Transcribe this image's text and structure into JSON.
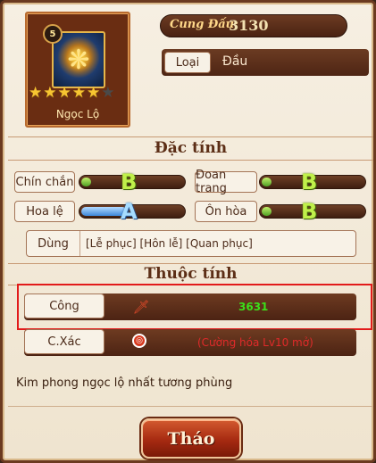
{
  "item": {
    "level": "5",
    "name": "Ngọc Lộ",
    "stars_total": 6,
    "stars_filled": 5
  },
  "power": {
    "label": "Cung Đấu:",
    "value": "3130"
  },
  "type": {
    "label": "Loại",
    "value": "Đầu"
  },
  "traits_section": {
    "title": "Đặc tính",
    "items": [
      {
        "name": "Chín chắn",
        "grade": "B",
        "level": 0.1,
        "color": "green"
      },
      {
        "name": "Đoan trang",
        "grade": "B",
        "level": 0.1,
        "color": "green"
      },
      {
        "name": "Hoa lệ",
        "grade": "A",
        "level": 0.45,
        "color": "blue"
      },
      {
        "name": "Ôn hòa",
        "grade": "B",
        "level": 0.1,
        "color": "green"
      }
    ]
  },
  "usage": {
    "label": "Dùng",
    "value": "[Lễ phục] [Hôn lễ] [Quan phục]"
  },
  "attributes_section": {
    "title": "Thuộc tính",
    "stats": [
      {
        "label": "Công",
        "icon": "dagger-icon",
        "value": "3631",
        "color": "#3be01a"
      },
      {
        "label": "C.Xác",
        "icon": "target-icon",
        "value": "(Cường hóa Lv10 mở)",
        "color": "#e02a2a"
      }
    ]
  },
  "description": "Kim phong ngọc lộ nhất tương phùng",
  "remove_button": "Tháo",
  "colors": {
    "panel_bg": "#f3ead8",
    "frame_brown": "#6b3a20",
    "highlight_red": "#e21b1b",
    "grade_green": "#c0f04a",
    "grade_blue": "#a6dcff"
  }
}
